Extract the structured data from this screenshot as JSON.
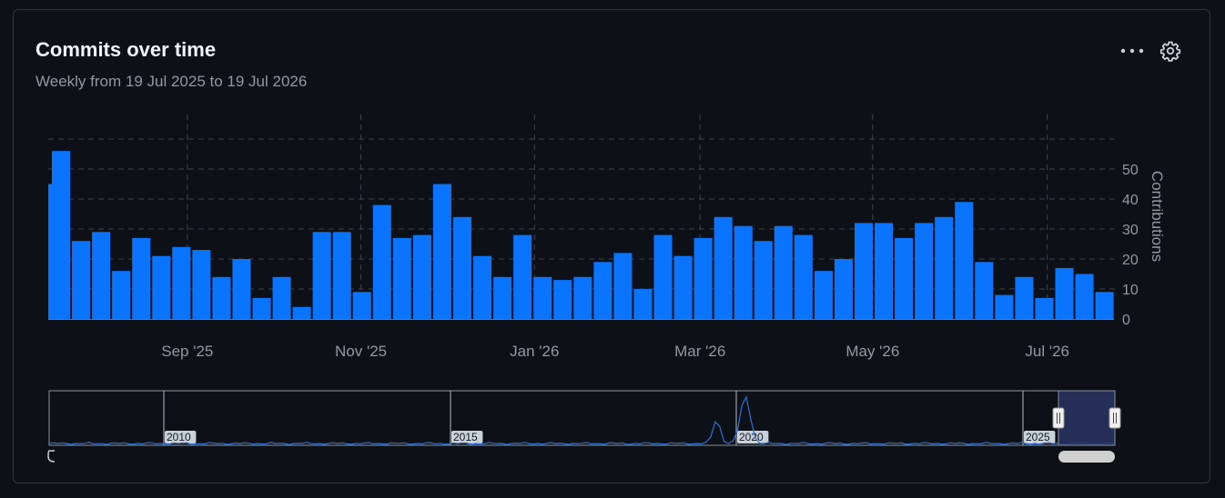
{
  "header": {
    "title": "Commits over time",
    "subtitle": "Weekly from 19 Jul 2025 to 19 Jul 2026",
    "more_icon": "kebab-horizontal-icon",
    "settings_icon": "gear-icon"
  },
  "colors": {
    "background": "#0d1117",
    "bar": "#0a74ff",
    "text_primary": "#f0f6fc",
    "text_muted": "#9198a1",
    "grid": "#3d444d",
    "navigator_selection": "#2a3463"
  },
  "chart_data": [
    {
      "type": "bar",
      "title": "Commits over time",
      "subtitle": "Weekly from 19 Jul 2025 to 19 Jul 2026",
      "ylabel": "Contributions",
      "xlabel": "",
      "ylim": [
        0,
        60
      ],
      "yticks": [
        0,
        10,
        20,
        30,
        40,
        50
      ],
      "grid": true,
      "y_axis_side": "right",
      "x_ticks": [
        {
          "label": "Sep '25",
          "bar_index": 6.75
        },
        {
          "label": "Nov '25",
          "bar_index": 15.4
        },
        {
          "label": "Jan '26",
          "bar_index": 24.05
        },
        {
          "label": "Mar '26",
          "bar_index": 32.3
        },
        {
          "label": "May '26",
          "bar_index": 40.9
        },
        {
          "label": "Jul '26",
          "bar_index": 49.6
        }
      ],
      "values": [
        45,
        56,
        26,
        29,
        16,
        27,
        21,
        24,
        23,
        14,
        20,
        7,
        14,
        4,
        29,
        29,
        9,
        38,
        27,
        28,
        45,
        34,
        21,
        14,
        28,
        14,
        13,
        14,
        19,
        22,
        10,
        28,
        21,
        27,
        34,
        31,
        26,
        31,
        28,
        16,
        20,
        32,
        32,
        27,
        32,
        34,
        39,
        19,
        8,
        14,
        7,
        17,
        15,
        9
      ]
    },
    {
      "type": "area",
      "role": "navigator",
      "x_labels": [
        "2010",
        "2015",
        "2020",
        "2025"
      ],
      "x_range": [
        2008,
        2026.6
      ],
      "selection": [
        2026.55,
        2027.55
      ],
      "note_peak_years": [
        2019.8,
        2020.2
      ]
    }
  ]
}
